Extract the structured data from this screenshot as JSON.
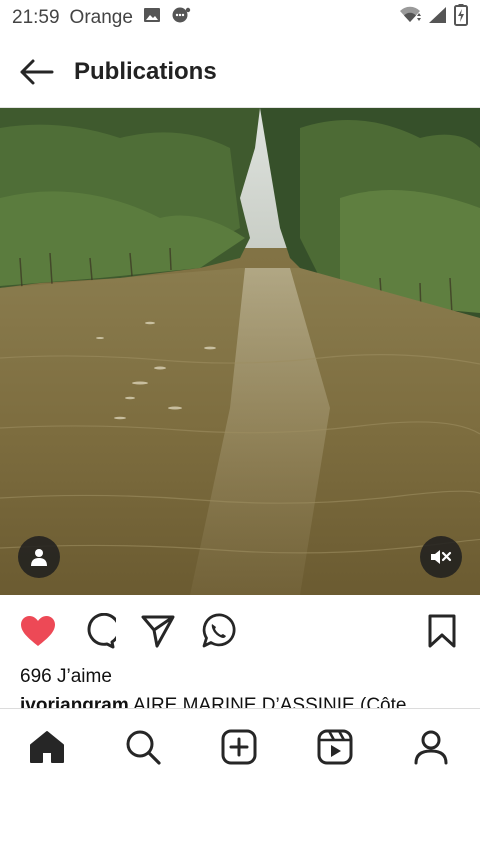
{
  "status_bar": {
    "time": "21:59",
    "carrier": "Orange"
  },
  "header": {
    "title": "Publications"
  },
  "post": {
    "likes_text": "696 J’aime",
    "caption_user": "ivoriangram",
    "caption_text": "AIRE MARINE D’ASSINIE (Côte"
  },
  "colors": {
    "like_red": "#ed4956",
    "icon_dark": "#262626"
  },
  "icons": {
    "back": "arrow-left-icon",
    "like": "heart-filled-icon",
    "comment": "comment-icon",
    "share": "paper-plane-icon",
    "whatsapp": "whatsapp-icon",
    "save": "bookmark-icon",
    "home": "home-icon",
    "search": "search-icon",
    "create": "plus-square-icon",
    "reels": "reels-icon",
    "profile": "profile-icon"
  }
}
